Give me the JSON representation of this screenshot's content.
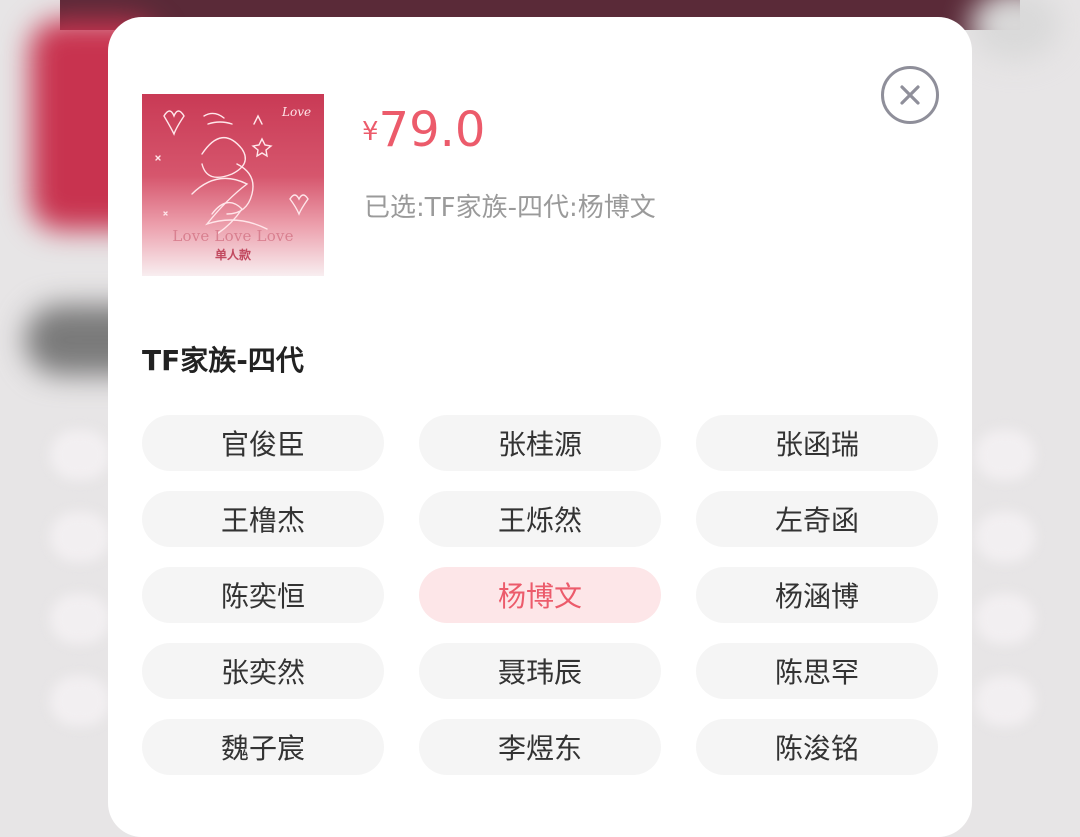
{
  "product": {
    "cover_icon": "album-cover-image",
    "cover_title": "Love Love Love",
    "cover_subtitle": "单人款",
    "currency_symbol": "¥",
    "price": "79.0",
    "selected_text": "已选:TF家族-四代:杨博文"
  },
  "close_icon": "close-icon",
  "group": {
    "title": "TF家族-四代",
    "options": [
      {
        "label": "官俊臣",
        "selected": false
      },
      {
        "label": "张桂源",
        "selected": false
      },
      {
        "label": "张函瑞",
        "selected": false
      },
      {
        "label": "王橹杰",
        "selected": false
      },
      {
        "label": "王烁然",
        "selected": false
      },
      {
        "label": "左奇函",
        "selected": false
      },
      {
        "label": "陈奕恒",
        "selected": false
      },
      {
        "label": "杨博文",
        "selected": true
      },
      {
        "label": "杨涵博",
        "selected": false
      },
      {
        "label": "张奕然",
        "selected": false
      },
      {
        "label": "聂玮辰",
        "selected": false
      },
      {
        "label": "陈思罕",
        "selected": false
      },
      {
        "label": "魏子宸",
        "selected": false
      },
      {
        "label": "李煜东",
        "selected": false
      },
      {
        "label": "陈浚铭",
        "selected": false
      }
    ]
  },
  "colors": {
    "accent": "#ec5b6b",
    "chip_bg": "#f5f5f5",
    "chip_selected_bg": "#fde6e8"
  }
}
